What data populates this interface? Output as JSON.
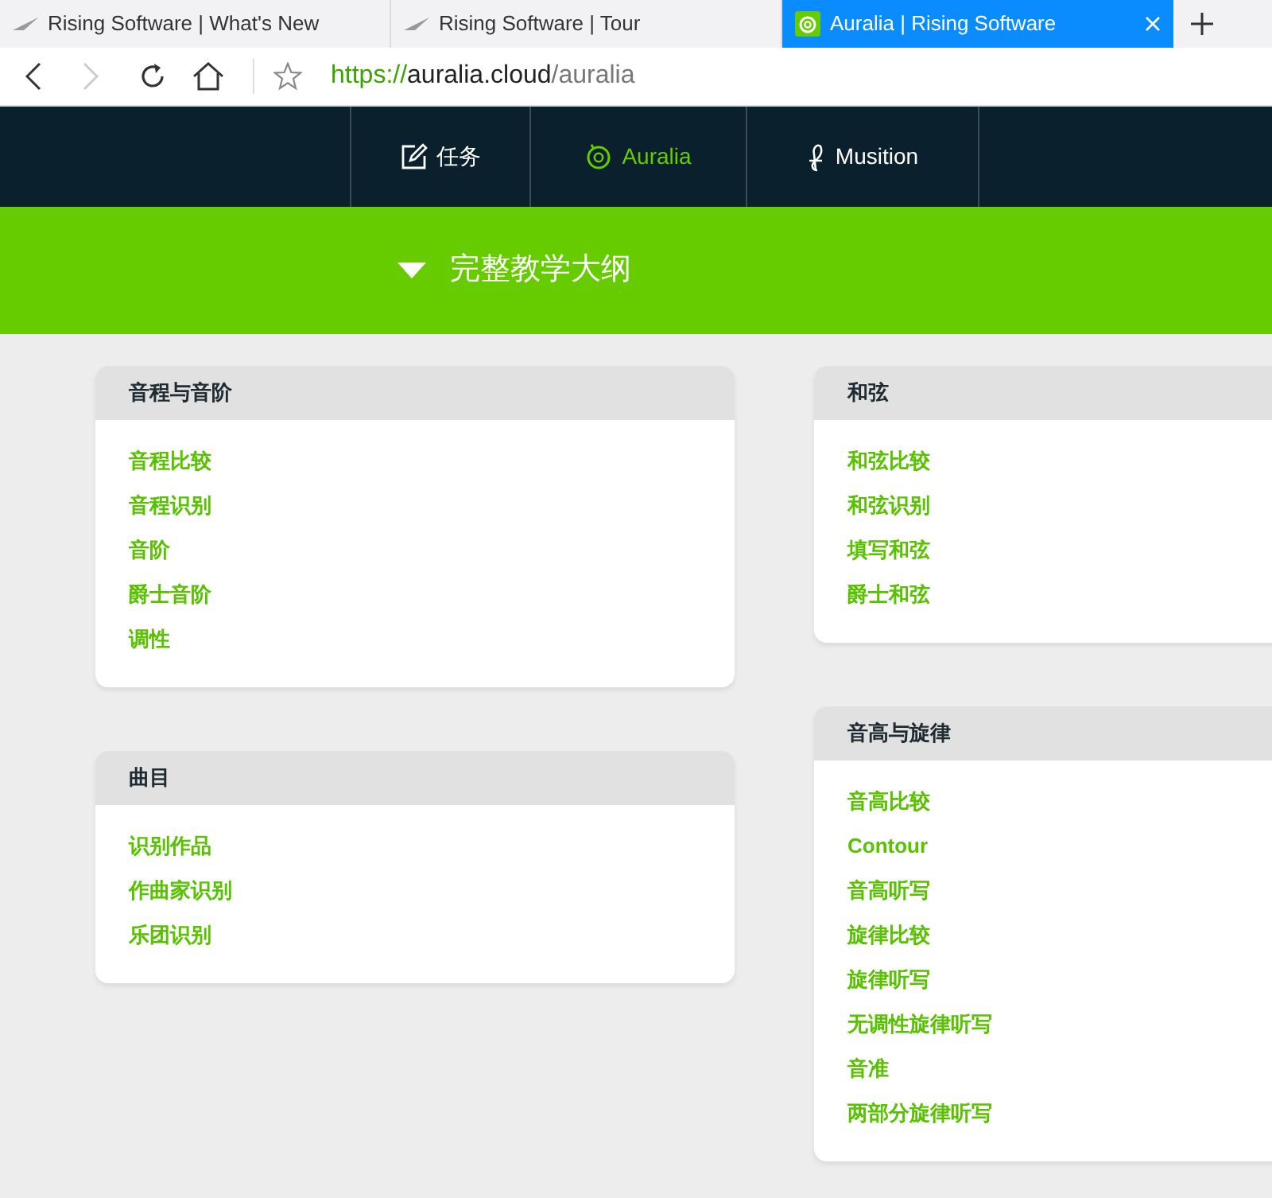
{
  "browser_tabs": [
    {
      "title": "Rising Software | What's New",
      "selected": false
    },
    {
      "title": "Rising Software | Tour",
      "selected": false
    },
    {
      "title": "Auralia | Rising Software",
      "selected": true
    }
  ],
  "address_bar": {
    "scheme": "https://",
    "host": "auralia.cloud",
    "path": "/auralia"
  },
  "nav": [
    {
      "label": "任务",
      "kind": "tasks",
      "selected": false
    },
    {
      "label": "Auralia",
      "kind": "auralia",
      "selected": true
    },
    {
      "label": "Musition",
      "kind": "musition",
      "selected": false
    }
  ],
  "syllabus": {
    "title": "完整教学大纲",
    "expanded": true
  },
  "columns": [
    [
      {
        "title": "音程与音阶",
        "items": [
          "音程比较",
          "音程识别",
          "音阶",
          "爵士音阶",
          "调性"
        ]
      },
      {
        "title": "曲目",
        "items": [
          "识别作品",
          "作曲家识别",
          "乐团识别"
        ]
      }
    ],
    [
      {
        "title": "和弦",
        "items": [
          "和弦比较",
          "和弦识别",
          "填写和弦",
          "爵士和弦"
        ]
      },
      {
        "title": "音高与旋律",
        "items": [
          "音高比较",
          "Contour",
          "音高听写",
          "旋律比较",
          "旋律听写",
          "无调性旋律听写",
          "音准",
          "两部分旋律听写"
        ]
      }
    ]
  ]
}
